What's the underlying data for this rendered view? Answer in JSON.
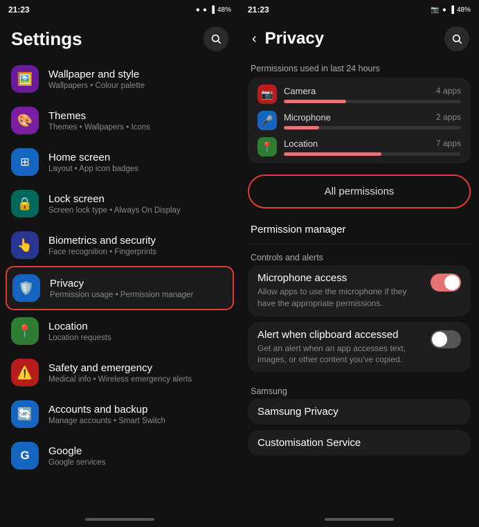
{
  "left": {
    "statusTime": "21:23",
    "statusIcons": "● ● ▪ ▪ Vxt 48%",
    "pageTitle": "Settings",
    "items": [
      {
        "id": "wallpaper",
        "icon": "🖼️",
        "iconBg": "#6a1b9a",
        "title": "Wallpaper and style",
        "subtitle": "Wallpapers • Colour palette"
      },
      {
        "id": "themes",
        "icon": "🎨",
        "iconBg": "#7b1fa2",
        "title": "Themes",
        "subtitle": "Themes • Wallpapers • Icons"
      },
      {
        "id": "homescreen",
        "icon": "⊞",
        "iconBg": "#1565c0",
        "title": "Home screen",
        "subtitle": "Layout • App icon badges"
      },
      {
        "id": "lockscreen",
        "icon": "🔒",
        "iconBg": "#00695c",
        "title": "Lock screen",
        "subtitle": "Screen lock type • Always On Display"
      },
      {
        "id": "biometrics",
        "icon": "👆",
        "iconBg": "#283593",
        "title": "Biometrics and security",
        "subtitle": "Face recognition • Fingerprints"
      },
      {
        "id": "privacy",
        "icon": "🛡️",
        "iconBg": "#1565c0",
        "title": "Privacy",
        "subtitle": "Permission usage • Permission manager",
        "highlighted": true
      },
      {
        "id": "location",
        "icon": "📍",
        "iconBg": "#2e7d32",
        "title": "Location",
        "subtitle": "Location requests"
      },
      {
        "id": "safety",
        "icon": "⚠️",
        "iconBg": "#b71c1c",
        "title": "Safety and emergency",
        "subtitle": "Medical info • Wireless emergency alerts"
      },
      {
        "id": "accounts",
        "icon": "🔄",
        "iconBg": "#1565c0",
        "title": "Accounts and backup",
        "subtitle": "Manage accounts • Smart Switch"
      },
      {
        "id": "google",
        "icon": "G",
        "iconBg": "#1565c0",
        "title": "Google",
        "subtitle": "Google services"
      }
    ]
  },
  "right": {
    "statusTime": "21:23",
    "statusIcons": "📷 ● ▪ Vxt 48%",
    "pageTitle": "Privacy",
    "sectionLabel": "Permissions used in last 24 hours",
    "permissions": [
      {
        "icon": "📷",
        "iconBg": "#b71c1c",
        "name": "Camera",
        "count": "4 apps",
        "barWidth": "35%"
      },
      {
        "icon": "🎤",
        "iconBg": "#1565c0",
        "name": "Microphone",
        "count": "2 apps",
        "barWidth": "20%"
      },
      {
        "icon": "📍",
        "iconBg": "#2e7d32",
        "name": "Location",
        "count": "7 apps",
        "barWidth": "55%"
      }
    ],
    "allPermissionsLabel": "All permissions",
    "permissionManagerLabel": "Permission manager",
    "controlsLabel": "Controls and alerts",
    "micAccessTitle": "Microphone access",
    "micAccessSubtitle": "Allow apps to use the microphone if they have the appropriate permissions.",
    "micToggle": "on",
    "clipboardTitle": "Alert when clipboard accessed",
    "clipboardSubtitle": "Get an alert when an app accesses text, images, or other content you've copied.",
    "clipboardToggle": "off",
    "samsungLabel": "Samsung",
    "samsungPrivacyTitle": "Samsung Privacy",
    "customisationTitle": "Customisation Service"
  }
}
